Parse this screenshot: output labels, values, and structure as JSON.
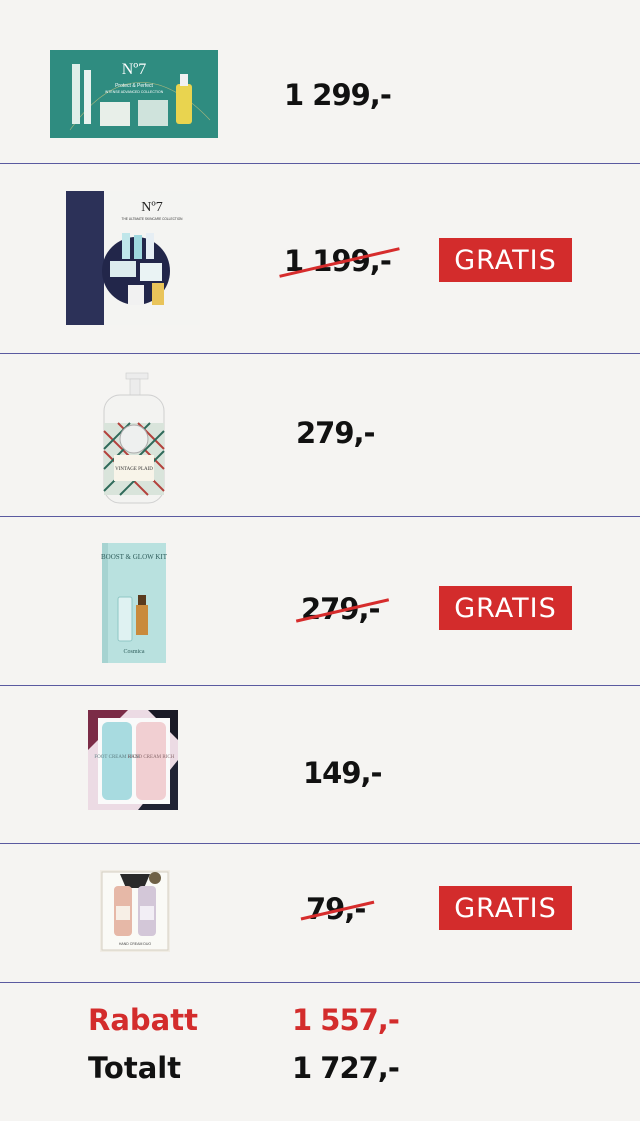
{
  "items": [
    {
      "product": "No7 Protect & Perfect Intense Advanced Collection",
      "price": "1 299,-",
      "free": false
    },
    {
      "product": "No7 The Ultimate Skincare Collection",
      "price": "1 199,-",
      "free": true,
      "badge": "GRATIS"
    },
    {
      "product": "Michel Design Works Foaming Hand Soap",
      "price": "279,-",
      "free": false
    },
    {
      "product": "Cosmica Boost & Glow Kit",
      "price": "279,-",
      "free": true,
      "badge": "GRATIS"
    },
    {
      "product": "Cosmica Foot & Hand Cream Rich set",
      "price": "149,-",
      "free": false
    },
    {
      "product": "Hand Cream Duo",
      "price": "79,-",
      "free": true,
      "badge": "GRATIS"
    }
  ],
  "summary": {
    "discount_label": "Rabatt",
    "discount_value": "1 557,-",
    "total_label": "Totalt",
    "total_value": "1 727,-",
    "accent_color": "#d32c2c",
    "divider_color": "#5a5aa0"
  },
  "product_text": {
    "no7_logo": "Nº7",
    "no7_set_title": "Protect & Perfect",
    "no7_set_subtitle": "INTENSE ADVANCED COLLECTION",
    "no7_ultimate_title": "THE ULTIMATE SKINCARE COLLECTION",
    "soap_label": "VINTAGE PLAID",
    "cosmica_kit_title": "BOOST & GLOW KIT",
    "cosmica_brand": "Cosmica",
    "foot_cream": "FOOT CREAM RICH",
    "hand_cream": "HAND CREAM RICH",
    "duo_label": "HAND CREAM DUO"
  }
}
